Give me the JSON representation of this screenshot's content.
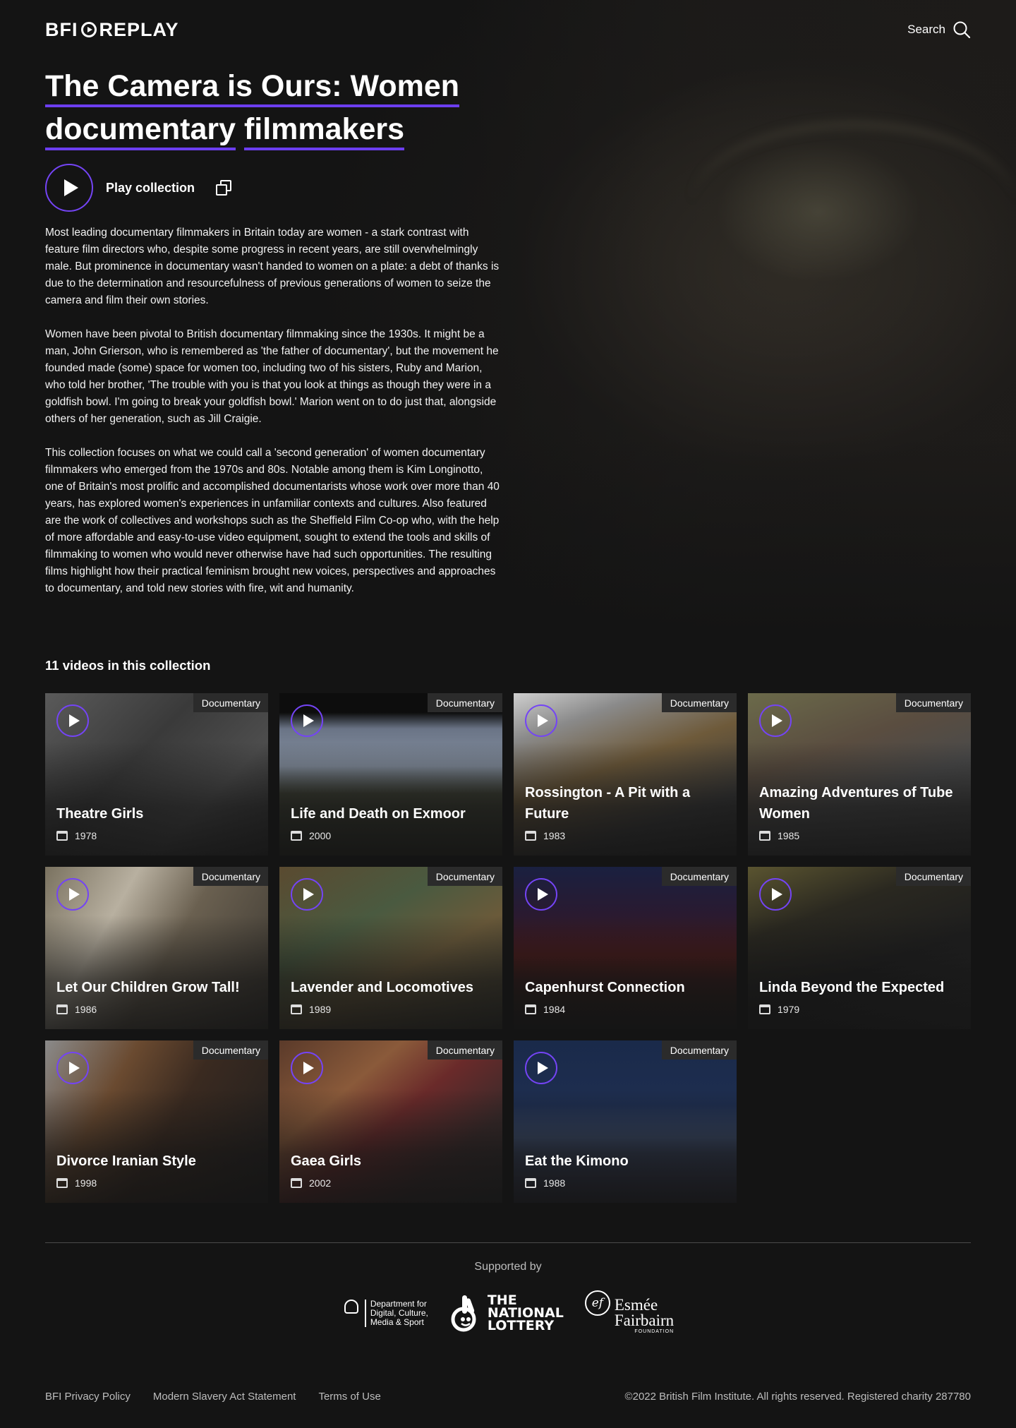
{
  "header": {
    "logo_left": "BFI",
    "logo_right": "REPLAY",
    "search_label": "Search"
  },
  "collection": {
    "title_line1": "The Camera is Ours: Women",
    "title_line2a": "documentary",
    "title_line2b": "filmmakers",
    "play_label": "Play collection",
    "paragraphs": [
      "Most leading documentary filmmakers in Britain today are women - a stark contrast with feature film directors who, despite some progress in recent years, are still overwhelmingly male. But prominence in documentary wasn't handed to women on a plate: a debt of thanks is due to the determination and resourcefulness of previous generations of women to seize the camera and film their own stories.",
      "Women have been pivotal to British documentary filmmaking since the 1930s. It might be a man, John Grierson, who is remembered as 'the father of documentary', but the movement he founded made (some) space for women too, including two of his sisters, Ruby and Marion, who told her brother, 'The trouble with you is that you look at things as though they were in a goldfish bowl. I'm going to break your goldfish bowl.' Marion went on to do just that, alongside others of her generation, such as Jill Craigie.",
      "This collection focuses on what we could call a 'second generation' of women documentary filmmakers who emerged from the 1970s and 80s. Notable among them is Kim Longinotto, one of Britain's most prolific and accomplished documentarists whose work over more than 40 years, has explored women's experiences in unfamiliar contexts and cultures. Also featured are the work of collectives and workshops such as the Sheffield Film Co-op who, with the help of more affordable and easy-to-use video equipment, sought to extend the tools and skills of filmmaking to women who would never otherwise have had such opportunities. The resulting films highlight how their practical feminism brought new voices, perspectives and approaches to documentary, and told new stories with fire, wit and humanity."
    ],
    "videos_heading": "11 videos in this collection"
  },
  "videos": [
    {
      "title": "Theatre Girls",
      "year": "1978",
      "badge": "Documentary",
      "bg": "linear-gradient(135deg,#5a5a5a 0%,#3a3a3a 40%,#4d4d4d 70%,#2f2f2f 100%)"
    },
    {
      "title": "Life and Death on Exmoor",
      "year": "2000",
      "badge": "Documentary",
      "bg": "linear-gradient(180deg,#0d0d0d 0%,#0d0d0d 12%,#6a7486 22%,#8590a0 45%,#3d4033 62%,#2a2c22 100%)"
    },
    {
      "title": "Rossington - A Pit with a Future",
      "year": "1983",
      "badge": "Documentary",
      "bg": "linear-gradient(160deg,#cfcfcf 0%,#8a8a8a 20%,#6e5a3a 45%,#3a3a3a 75%,#2a2a2a 100%)"
    },
    {
      "title": "Amazing Adventures of Tube Women",
      "year": "1985",
      "badge": "Documentary",
      "bg": "linear-gradient(160deg,#6b6a4a 0%,#5a4d40 35%,#4a4a4a 60%,#3c3c3c 100%)"
    },
    {
      "title": "Let Our Children Grow Tall!",
      "year": "1986",
      "badge": "Documentary",
      "bg": "linear-gradient(120deg,#7a7260 0%,#b8b0a0 30%,#6a6050 55%,#3a3630 100%)"
    },
    {
      "title": "Lavender and Locomotives",
      "year": "1989",
      "badge": "Documentary",
      "bg": "linear-gradient(150deg,#5a4a30 0%,#4a5a40 35%,#6a5a3a 60%,#3a3a30 100%)"
    },
    {
      "title": "Capenhurst Connection",
      "year": "1984",
      "badge": "Documentary",
      "bg": "linear-gradient(180deg,#1a2040 0%,#2a1a30 30%,#4a1a1a 55%,#2a1a18 80%,#1a1a1a 100%)"
    },
    {
      "title": "Linda Beyond the Expected",
      "year": "1979",
      "badge": "Documentary",
      "bg": "linear-gradient(160deg,#5a5430 0%,#2a2820 30%,#1e1e1e 60%,#2a2a2a 100%)"
    },
    {
      "title": "Divorce Iranian Style",
      "year": "1998",
      "badge": "Documentary",
      "bg": "linear-gradient(120deg,#8a8a8a 0%,#6a4a30 30%,#3a2a20 55%,#1e1e1e 100%)"
    },
    {
      "title": "Gaea Girls",
      "year": "2002",
      "badge": "Documentary",
      "bg": "linear-gradient(140deg,#5a3a2a 0%,#8a5a3a 30%,#6a2a2a 50%,#3a2a2a 75%,#2a2a2a 100%)"
    },
    {
      "title": "Eat the Kimono",
      "year": "1988",
      "badge": "Documentary",
      "bg": "linear-gradient(180deg,#1a2a4a 0%,#1e2e50 40%,#3a4a6a 60%,#2a2a3a 100%)"
    }
  ],
  "footer": {
    "supported_by": "Supported by",
    "dcms_text_1": "Department for",
    "dcms_text_2": "Digital, Culture,",
    "dcms_text_3": "Media & Sport",
    "lottery_1": "THE",
    "lottery_2": "NATIONAL",
    "lottery_3": "LOTTERY",
    "esmee_ef": "ef",
    "esmee_1": "Esmée",
    "esmee_2": "Fairbairn",
    "esmee_3": "FOUNDATION",
    "links": [
      "BFI Privacy Policy",
      "Modern Slavery Act Statement",
      "Terms of Use"
    ],
    "copyright": "©2022 British Film Institute. All rights reserved. Registered charity 287780"
  },
  "colors": {
    "accent": "#7444f5",
    "background": "#141414"
  }
}
